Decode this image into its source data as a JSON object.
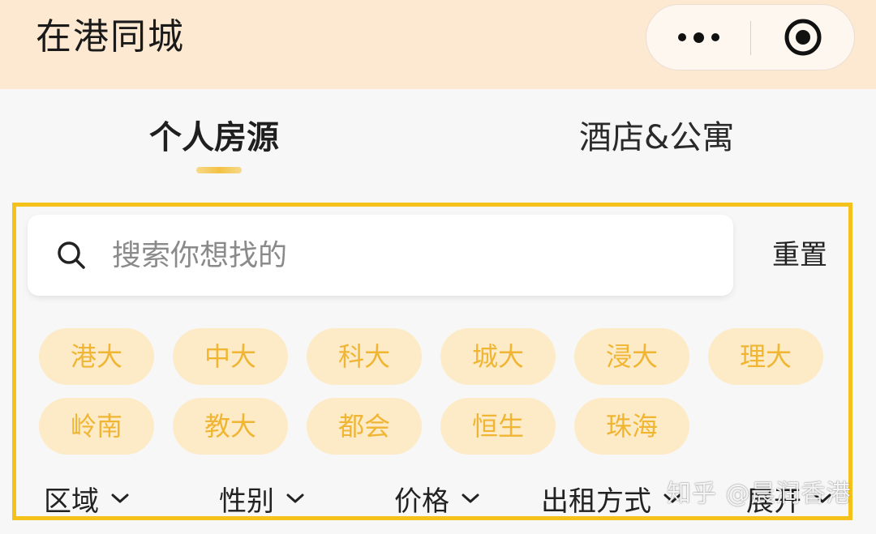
{
  "header": {
    "title": "在港同城",
    "bg_color": "#fde9d1",
    "more_icon": "more-dots-icon",
    "close_icon": "target-close-icon"
  },
  "tabs": [
    {
      "label": "个人房源",
      "active": true
    },
    {
      "label": "酒店&公寓",
      "active": false
    }
  ],
  "search": {
    "placeholder": "搜索你想找的",
    "value": "",
    "icon": "search-icon",
    "reset_label": "重置"
  },
  "tags": [
    "港大",
    "中大",
    "科大",
    "城大",
    "浸大",
    "理大",
    "岭南",
    "教大",
    "都会",
    "恒生",
    "珠海"
  ],
  "filters": [
    {
      "label": "区域",
      "icon": "chevron-down-icon"
    },
    {
      "label": "性别",
      "icon": "chevron-down-icon"
    },
    {
      "label": "价格",
      "icon": "chevron-down-icon"
    },
    {
      "label": "出租方式",
      "icon": "chevron-down-icon"
    },
    {
      "label": "展开",
      "icon": "chevron-down-icon"
    }
  ],
  "watermark": "知乎 @晨润香港",
  "colors": {
    "accent_yellow": "#f4c21a",
    "tag_bg": "#fdebc8",
    "tag_text": "#f0b533"
  }
}
